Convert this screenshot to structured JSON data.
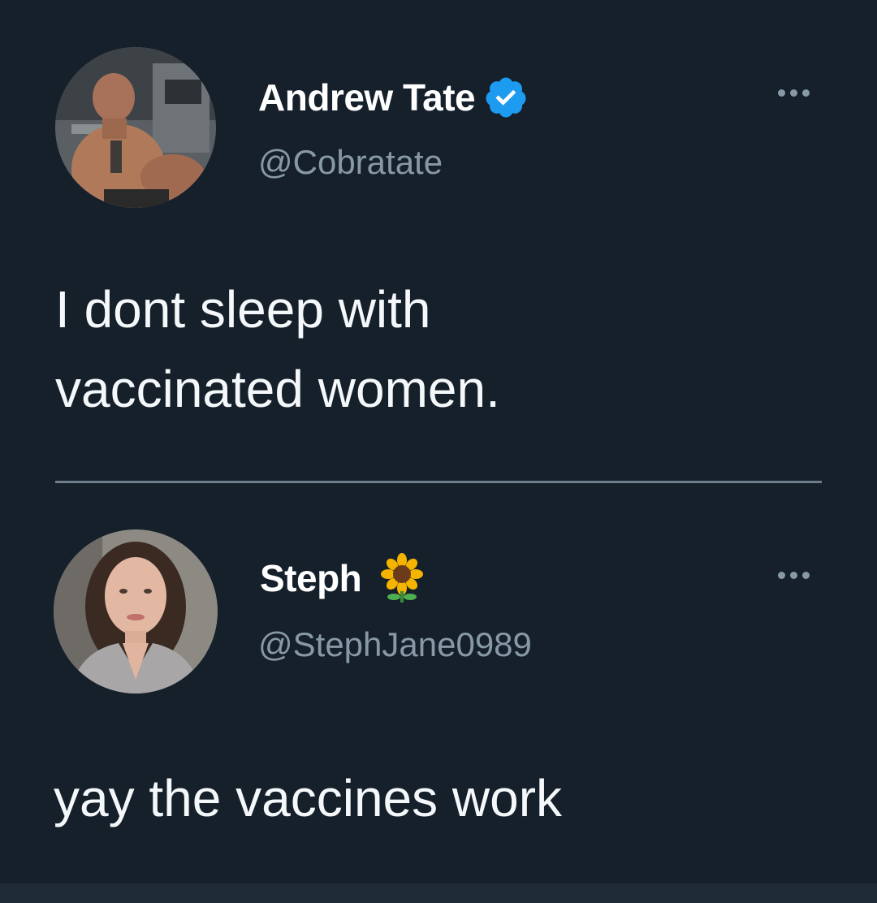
{
  "tweets": [
    {
      "display_name": "Andrew Tate",
      "handle": "@Cobratate",
      "verified": true,
      "text_lines": [
        "I dont sleep with",
        "vaccinated women."
      ],
      "avatar_icon": "avatar-man-shirtless-gym"
    },
    {
      "display_name": "Steph",
      "handle": "@StephJane0989",
      "name_emoji": "sunflower",
      "text_lines": [
        "yay the vaccines work"
      ],
      "avatar_icon": "avatar-woman-dark-hair"
    }
  ],
  "colors": {
    "background": "#15202b",
    "verified_badge": "#1d9bf0",
    "secondary_text": "#8899a6",
    "divider": "#6e7d8a"
  }
}
